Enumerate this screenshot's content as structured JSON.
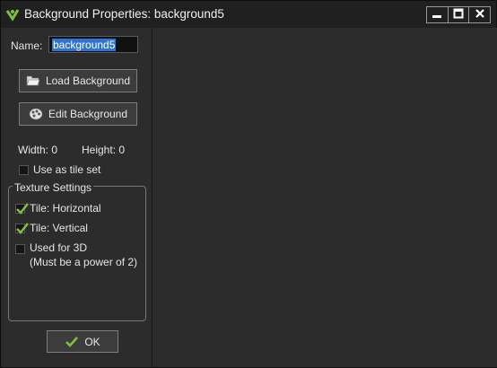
{
  "window": {
    "title": "Background Properties: background5"
  },
  "name_field": {
    "label": "Name:",
    "value": "background5"
  },
  "buttons": {
    "load": "Load Background",
    "edit": "Edit Background",
    "ok": "OK"
  },
  "info": {
    "width": "Width: 0",
    "height": "Height: 0"
  },
  "tileset": {
    "label": "Use as tile set",
    "checked": false
  },
  "texture": {
    "title": "Texture Settings",
    "tile_horizontal": {
      "label": "Tile: Horizontal",
      "checked": true
    },
    "tile_vertical": {
      "label": "Tile: Vertical",
      "checked": true
    },
    "used_3d": {
      "label": "Used for 3D",
      "note": "(Must be a power of 2)",
      "checked": false
    }
  },
  "colors": {
    "accent_check": "#7fc23a",
    "selection": "#2f74d0"
  },
  "icons": [
    "gamemaker-icon",
    "minimize-icon",
    "maximize-icon",
    "close-icon",
    "folder-open-icon",
    "palette-icon",
    "checkmark-icon"
  ]
}
